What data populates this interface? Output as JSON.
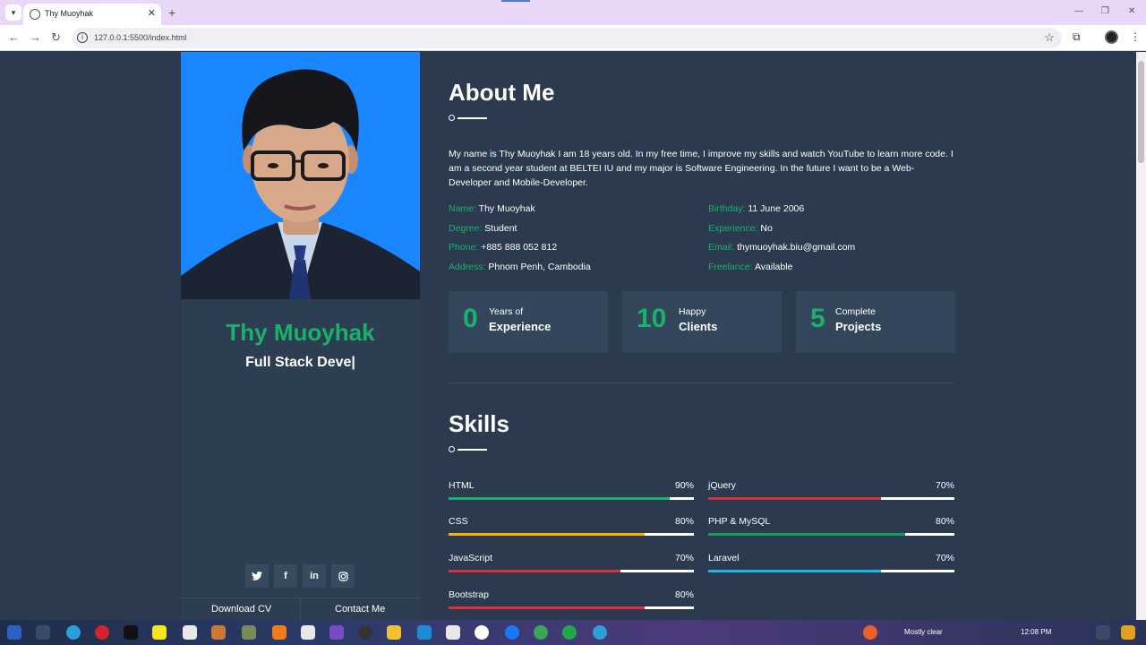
{
  "browser": {
    "tab_title": "Thy Muoyhak",
    "url": "127.0.0.1:5500/index.html"
  },
  "sidebar": {
    "name": "Thy Muoyhak",
    "typed_title": "Full Stack Deve|",
    "social": [
      "twitter-icon",
      "facebook-icon",
      "linkedin-icon",
      "instagram-icon"
    ],
    "buttons": {
      "download": "Download CV",
      "contact": "Contact Me"
    }
  },
  "about": {
    "title": "About Me",
    "text": "My name is Thy Muoyhak I am 18 years old. In my free time, I improve my skills and watch YouTube to learn more code. I am a second year student at BELTEI IU and my major is Software Engineering. In the future I want to be a Web-Developer and Mobile-Developer.",
    "info_left": [
      {
        "label": "Name:",
        "value": "Thy Muoyhak"
      },
      {
        "label": "Degree:",
        "value": "Student"
      },
      {
        "label": "Phone:",
        "value": "+885 888 052 812"
      },
      {
        "label": "Address:",
        "value": "Phnom Penh, Cambodia"
      }
    ],
    "info_right": [
      {
        "label": "Birthday:",
        "value": "11 June 2006"
      },
      {
        "label": "Experience:",
        "value": "No"
      },
      {
        "label": "Email:",
        "value": "thymuoyhak.biu@gmail.com"
      },
      {
        "label": "Freelance:",
        "value": "Available"
      }
    ],
    "stats": [
      {
        "number": "0",
        "small": "Years of",
        "big": "Experience"
      },
      {
        "number": "10",
        "small": "Happy",
        "big": "Clients"
      },
      {
        "number": "5",
        "small": "Complete",
        "big": "Projects"
      }
    ]
  },
  "skills": {
    "title": "Skills",
    "left": [
      {
        "name": "HTML",
        "percent": "90%",
        "level": 0.9,
        "color": "#19b26b"
      },
      {
        "name": "CSS",
        "percent": "80%",
        "level": 0.8,
        "color": "#f5b50a"
      },
      {
        "name": "JavaScript",
        "percent": "70%",
        "level": 0.7,
        "color": "#d6343c"
      },
      {
        "name": "Bootstrap",
        "percent": "80%",
        "level": 0.8,
        "color": "#d6343c"
      }
    ],
    "right": [
      {
        "name": "jQuery",
        "percent": "70%",
        "level": 0.7,
        "color": "#d6343c"
      },
      {
        "name": "PHP & MySQL",
        "percent": "80%",
        "level": 0.8,
        "color": "#1a9a4f"
      },
      {
        "name": "Laravel",
        "percent": "70%",
        "level": 0.7,
        "color": "#1ab8e0"
      }
    ]
  },
  "taskbar": {
    "weather_text": "Mostly clear",
    "clock": "12:08 PM"
  }
}
